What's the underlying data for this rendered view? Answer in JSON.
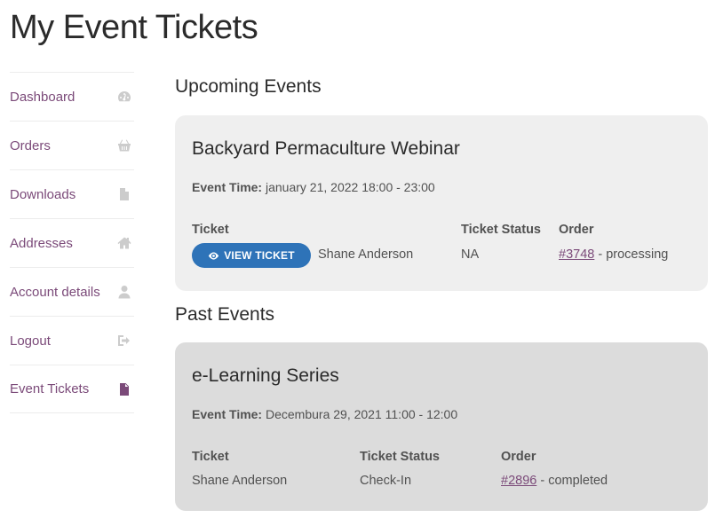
{
  "page": {
    "title": "My Event Tickets"
  },
  "sidebar": {
    "items": [
      {
        "label": "Dashboard",
        "icon": "dashboard-gauge-icon"
      },
      {
        "label": "Orders",
        "icon": "basket-icon"
      },
      {
        "label": "Downloads",
        "icon": "file-download-icon"
      },
      {
        "label": "Addresses",
        "icon": "home-icon"
      },
      {
        "label": "Account details",
        "icon": "user-icon"
      },
      {
        "label": "Logout",
        "icon": "sign-out-icon"
      },
      {
        "label": "Event Tickets",
        "icon": "document-icon",
        "active": true
      }
    ]
  },
  "upcoming": {
    "section_title": "Upcoming Events",
    "event_name": "Backyard Permaculture Webinar",
    "event_time_label": "Event Time:",
    "event_time_value": "january 21, 2022 18:00 - 23:00",
    "headers": {
      "ticket": "Ticket",
      "status": "Ticket Status",
      "order": "Order"
    },
    "button_label": "VIEW TICKET",
    "attendee": "Shane Anderson",
    "status": "NA",
    "order_number": "#3748",
    "order_state": " - processing"
  },
  "past": {
    "section_title": "Past Events",
    "event_name": "e-Learning Series",
    "event_time_label": "Event Time:",
    "event_time_value": "Decembura 29, 2021 11:00 - 12:00",
    "headers": {
      "ticket": "Ticket",
      "status": "Ticket Status",
      "order": "Order"
    },
    "attendee": "Shane Anderson",
    "status": "Check-In",
    "order_number": "#2896",
    "order_state": " - completed"
  },
  "colors": {
    "accent": "#7b4a79",
    "button": "#2e73b8",
    "card_upcoming": "#efefef",
    "card_past": "#dcdcdc"
  }
}
